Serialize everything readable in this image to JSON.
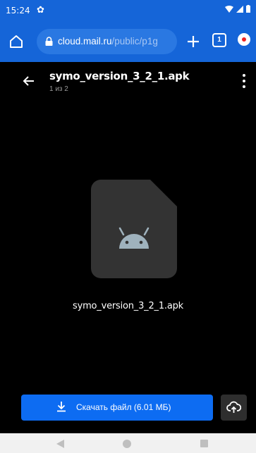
{
  "status": {
    "time": "15:24"
  },
  "browser": {
    "url_domain": "cloud.mail.ru",
    "url_path": "/public/p1g",
    "tab_count": "1"
  },
  "viewer": {
    "title": "symo_version_3_2_1.apk",
    "subtitle": "1 из 2",
    "file_name": "symo_version_3_2_1.apk",
    "download_label": "Скачать файл (6.01 МБ)"
  },
  "colors": {
    "browser_bar": "#1565d8",
    "download_button": "#0d6cf2",
    "file_card": "#333333",
    "android": "#9fb2bd"
  },
  "icons": [
    "home-icon",
    "lock-icon",
    "plus-icon",
    "tabs-icon",
    "menu-icon",
    "back-arrow-icon",
    "more-vert-icon",
    "android-icon",
    "download-icon",
    "cloud-upload-icon"
  ]
}
